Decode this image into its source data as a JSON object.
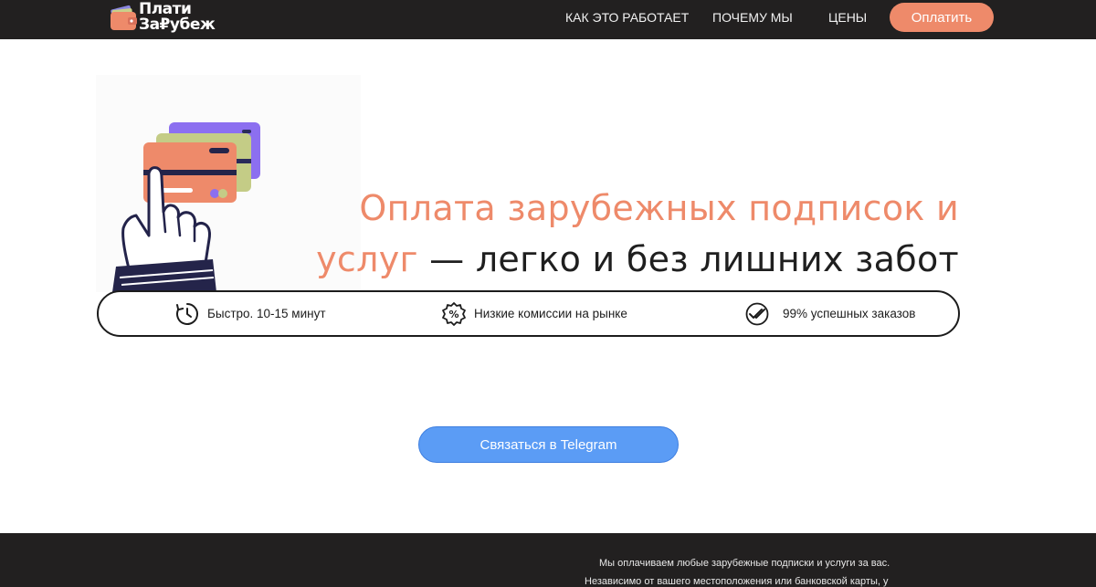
{
  "header": {
    "logo": {
      "line1": "Плати",
      "line2": "За₽убеж"
    },
    "nav": [
      {
        "label": "КАК ЭТО РАБОТАЕТ"
      },
      {
        "label": "ПОЧЕМУ МЫ"
      },
      {
        "label": "ЦЕНЫ"
      }
    ],
    "pay_button": "Оплатить"
  },
  "hero": {
    "headline_accent_1": "Оплата зарубежных подписок и",
    "headline_accent_2": "услуг",
    "headline_dark": " — легко и без лишних забот"
  },
  "features": [
    {
      "icon": "clock-icon",
      "text": "Быстро. 10-15 минут"
    },
    {
      "icon": "percent-badge-icon",
      "text": "Низкие комиссии на рынке"
    },
    {
      "icon": "double-check-icon",
      "text": "99% успешных заказов"
    }
  ],
  "cta": {
    "telegram_label": "Связаться в Telegram"
  },
  "footer": {
    "line1": "Мы оплачиваем любые зарубежные подписки и услуги за вас.",
    "line2": "Независимо от вашего местоположения или банковской карты, у"
  },
  "colors": {
    "accent": "#ee8a6a",
    "dark_bg": "#222020",
    "telegram_blue": "#5b9cf5"
  }
}
